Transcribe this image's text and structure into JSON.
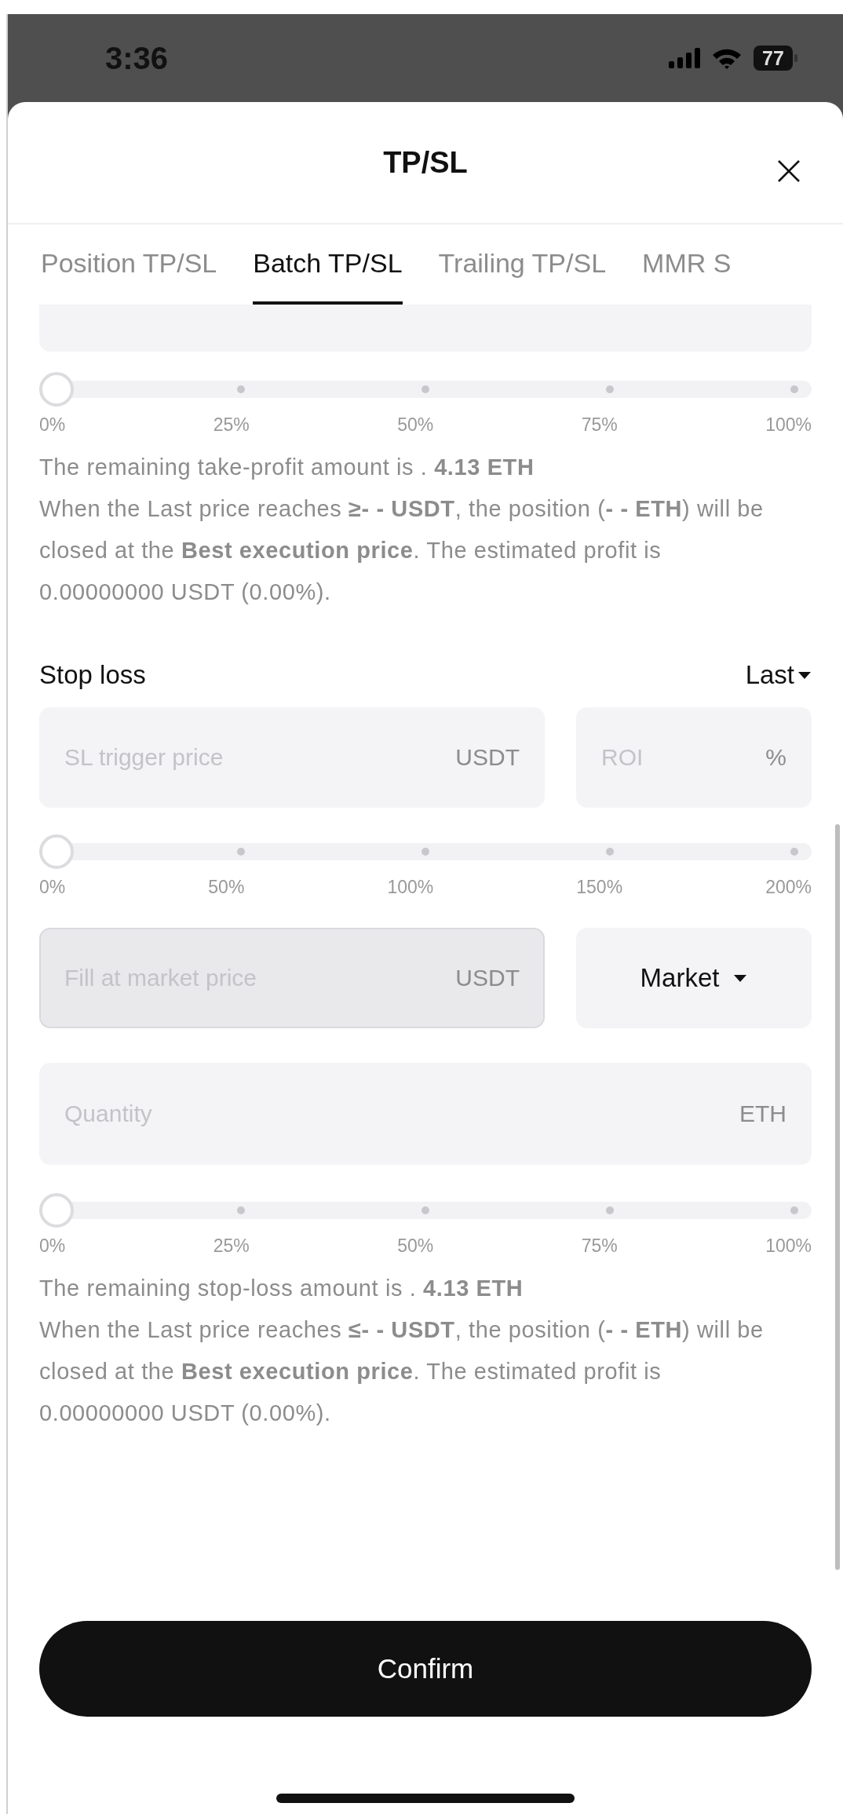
{
  "status_bar": {
    "time": "3:36",
    "battery": "77"
  },
  "sheet": {
    "title": "TP/SL"
  },
  "tabs": [
    {
      "label": "Position TP/SL",
      "selected": false
    },
    {
      "label": "Batch TP/SL",
      "selected": true
    },
    {
      "label": "Trailing TP/SL",
      "selected": false
    },
    {
      "label": "MMR S",
      "selected": false
    }
  ],
  "take_profit": {
    "quantity_slider": {
      "level": 0,
      "ticks": [
        "0%",
        "25%",
        "50%",
        "75%",
        "100%"
      ]
    },
    "remaining": "The remaining take-profit amount is . **4.13 ETH**",
    "summary": "When the Last price reaches **≥- - USDT**, the position (**- - ETH**) will be closed at the **Best execution price**. The estimated profit is 0.00000000 USDT (0.00%)."
  },
  "stop_loss": {
    "title": "Stop loss",
    "trigger_type": "Last",
    "trigger_field": {
      "placeholder": "SL trigger price",
      "unit": "USDT"
    },
    "roi_field": {
      "placeholder": "ROI",
      "unit": "%"
    },
    "roi_slider": {
      "level": 0,
      "ticks": [
        "0%",
        "50%",
        "100%",
        "150%",
        "200%"
      ]
    },
    "price_field": {
      "placeholder": "Fill at market price",
      "unit": "USDT",
      "disabled": true
    },
    "order_type": "Market",
    "quantity_field": {
      "placeholder": "Quantity",
      "unit": "ETH"
    },
    "quantity_slider": {
      "level": 0,
      "ticks": [
        "0%",
        "25%",
        "50%",
        "75%",
        "100%"
      ]
    },
    "remaining": "The remaining stop-loss amount is . **4.13 ETH**",
    "summary": "When the Last price reaches **≤- - USDT**, the position (**- - ETH**) will be closed at the **Best execution price**. The estimated profit is 0.00000000 USDT (0.00%)."
  },
  "confirm_button": "Confirm"
}
